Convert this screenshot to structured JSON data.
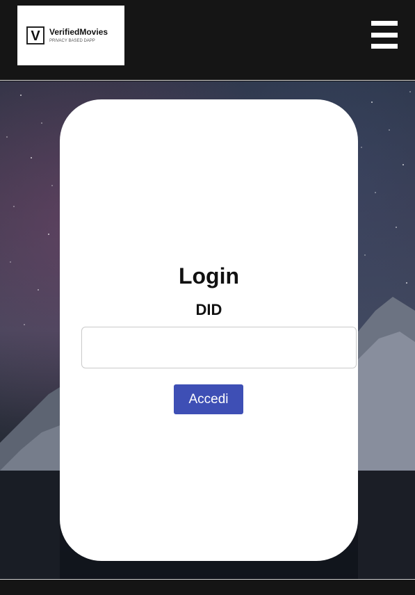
{
  "header": {
    "logo": {
      "mark": "V",
      "brand": "VerifiedMovies",
      "tagline": "PRIVACY BASED DAPP"
    },
    "menu_icon": "hamburger-menu-icon"
  },
  "login": {
    "title": "Login",
    "field_label": "DID",
    "input_value": "",
    "input_placeholder": "",
    "submit_label": "Accedi"
  },
  "colors": {
    "header_bg": "#151515",
    "card_bg": "#ffffff",
    "button_bg": "#3e4fb5",
    "button_text": "#ffffff"
  }
}
